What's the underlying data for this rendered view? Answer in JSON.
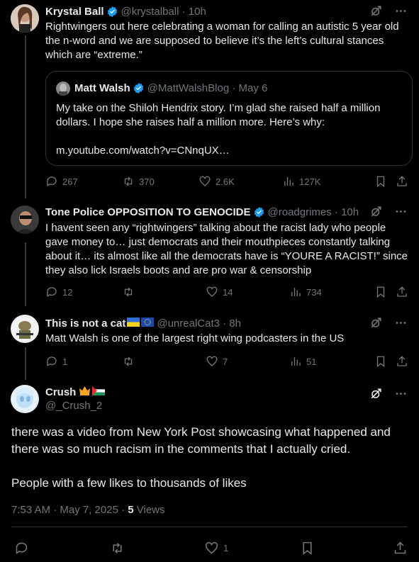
{
  "posts": [
    {
      "name": "Krystal Ball",
      "handle": "@krystalball · 10h",
      "text": "Rightwingers out here celebrating a woman for calling an autistic 5 year old the n-word and we are supposed to believe it’s the left’s cultural stances which are “extreme.”",
      "quote": {
        "name": "Matt Walsh",
        "handle": "@MattWalshBlog · May 6",
        "text": "My take on the Shiloh Hendrix story. I’m glad she raised half a million dollars. I hope she raises half a million more. Here’s why:",
        "link": "m.youtube.com/watch?v=CNnqUX…"
      },
      "replies": "267",
      "reposts": "370",
      "likes": "2.6K",
      "views": "127K"
    },
    {
      "name": "Tone Police OPPOSITION TO GENOCIDE",
      "handle": "@roadgrimes · 10h",
      "text": "I havent seen any “rightwingers” talking about the racist lady who people gave money to… just democrats and their mouthpieces constantly talking about it… its almost like all the democrats have is “YOURE A RACIST!” since they also lick Israels boots and are pro war & censorship",
      "replies": "12",
      "reposts": "",
      "likes": "14",
      "views": "734"
    },
    {
      "name": "This is not a cat",
      "handle": "@unrealCat3 · 8h",
      "text": "Matt Walsh is one of the largest right wing podcasters in the US",
      "replies": "1",
      "reposts": "",
      "likes": "7",
      "views": "51"
    }
  ],
  "main": {
    "name": "Crush",
    "handle": "@_Crush_2",
    "text1": "there was a video from New York Post showcasing what happened and there was so much racism in the comments that I actually cried.",
    "text2": "People with a few likes to thousands of likes",
    "timestamp": "7:53 AM · May 7, 2025 · ",
    "views_count": "5",
    "views_label": " Views",
    "likes": "1"
  },
  "colors": {
    "background": "#000000",
    "text": "#e7e9ea",
    "muted": "#71767b",
    "verified": "#1d9bf0",
    "border": "#2f3336"
  }
}
